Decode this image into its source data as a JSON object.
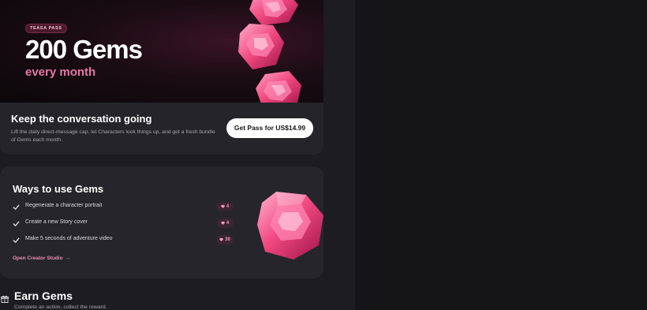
{
  "hero": {
    "badge": "TEASA PASS",
    "title": "200 Gems",
    "subtitle": "every month"
  },
  "promo": {
    "title": "Keep the conversation going",
    "description": "Lift the daily direct-message cap, let Characters look things up, and get a fresh bundle of Gems each month.",
    "cta_label": "Get Pass for US$14.99"
  },
  "ways": {
    "title": "Ways to use Gems",
    "items": [
      {
        "label": "Regenerate a character portrait",
        "cost": "4"
      },
      {
        "label": "Create a new Story cover",
        "cost": "4"
      },
      {
        "label": "Make 5 seconds of adventure video",
        "cost": "30"
      }
    ],
    "link_label": "Open Creator Studio",
    "link_arrow": "→"
  },
  "earn": {
    "title": "Earn Gems",
    "subtitle": "Complete an action, collect the reward."
  },
  "colors": {
    "accent_pink": "#e579a6",
    "gem_pink": "#f0467e",
    "background": "#151518",
    "card": "#26252b"
  },
  "icons": {
    "check": "check-icon",
    "gem": "gem-icon",
    "gift": "gift-icon",
    "arrow": "arrow-right-icon"
  }
}
